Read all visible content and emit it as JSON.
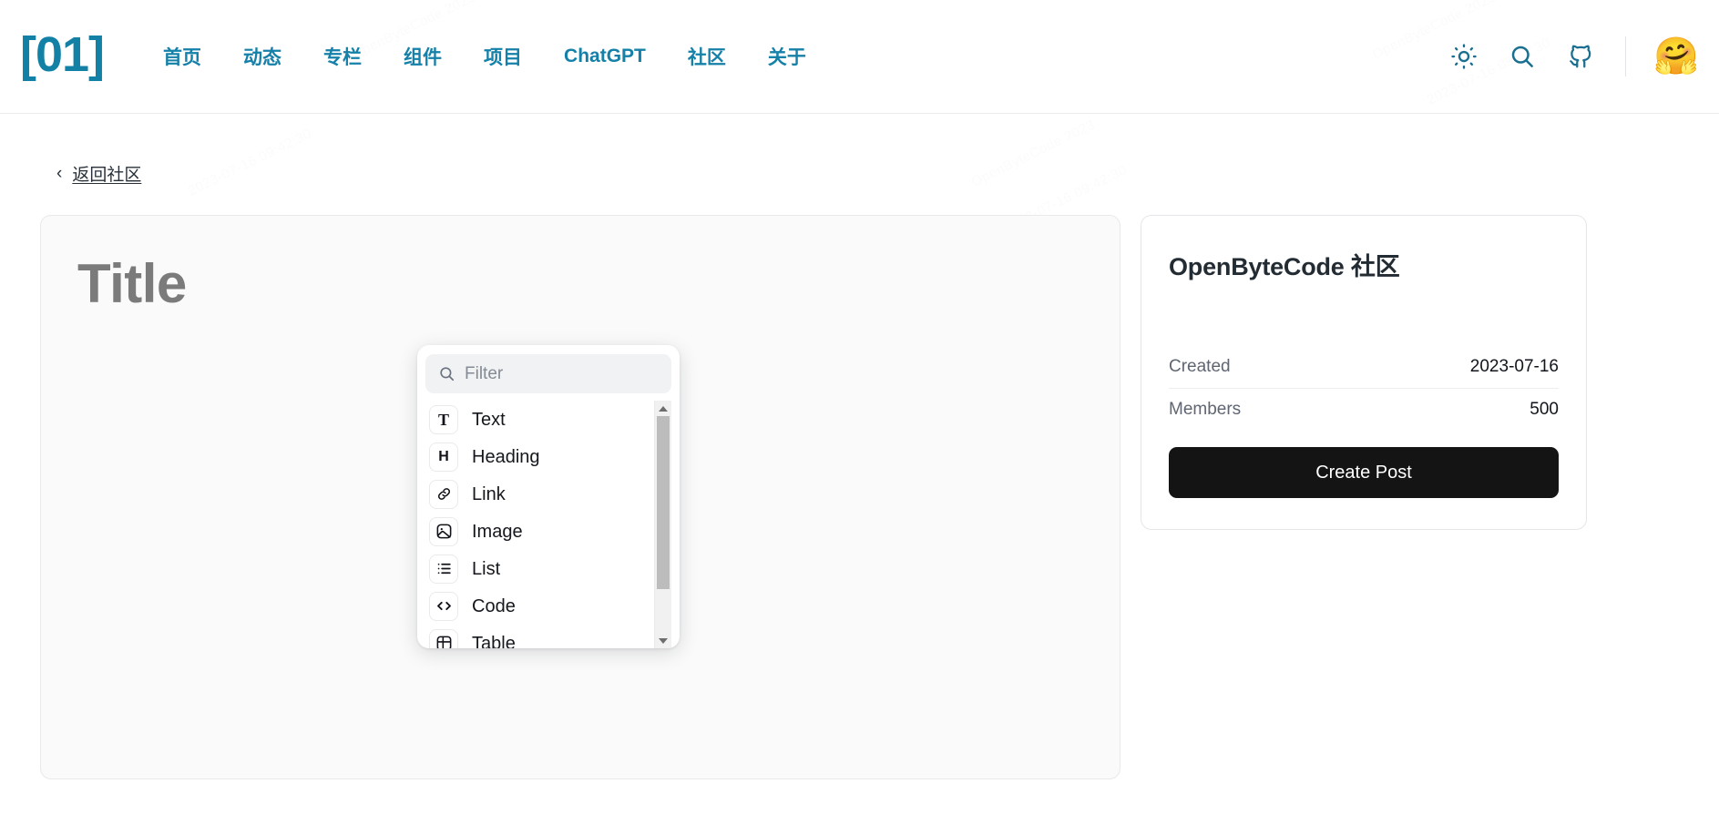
{
  "header": {
    "logo": "[01]",
    "nav": [
      {
        "label": "首页"
      },
      {
        "label": "动态"
      },
      {
        "label": "专栏"
      },
      {
        "label": "组件"
      },
      {
        "label": "项目"
      },
      {
        "label": "ChatGPT"
      },
      {
        "label": "社区"
      },
      {
        "label": "关于"
      }
    ],
    "actions": {
      "theme_toggle": "sun-icon",
      "search": "search-icon",
      "github": "github-icon",
      "avatar": "🤗"
    }
  },
  "breadcrumb": {
    "chevron": "‹",
    "back_label": "返回社区"
  },
  "editor": {
    "title_placeholder": "Title",
    "add_block": "+"
  },
  "block_menu": {
    "filter_placeholder": "Filter",
    "filter_value": "",
    "search_icon": "search-icon",
    "items": [
      {
        "label": "Text",
        "icon": "text-icon",
        "glyph": "T"
      },
      {
        "label": "Heading",
        "icon": "heading-icon",
        "glyph": "H"
      },
      {
        "label": "Link",
        "icon": "link-icon",
        "glyph": ""
      },
      {
        "label": "Image",
        "icon": "image-icon",
        "glyph": ""
      },
      {
        "label": "List",
        "icon": "list-icon",
        "glyph": ""
      },
      {
        "label": "Code",
        "icon": "code-icon",
        "glyph": "<>"
      },
      {
        "label": "Table",
        "icon": "table-icon",
        "glyph": ""
      }
    ],
    "scrollbar": {
      "up": "▲",
      "down": "▼"
    }
  },
  "sidebar": {
    "title": "OpenByteCode 社区",
    "stats": [
      {
        "label": "Created",
        "value": "2023-07-16"
      },
      {
        "label": "Members",
        "value": "500"
      }
    ],
    "create_post_label": "Create Post"
  },
  "colors": {
    "brand": "#1580a8",
    "button_dark": "#141414",
    "title_placeholder": "#7b7b7b",
    "card_bg": "#fafafa",
    "border": "#e6e6ea"
  },
  "watermark": {
    "lines": [
      "2023-07-16 09:42:30",
      "OpenByteCode 2023",
      "09-19-30 2023"
    ]
  }
}
